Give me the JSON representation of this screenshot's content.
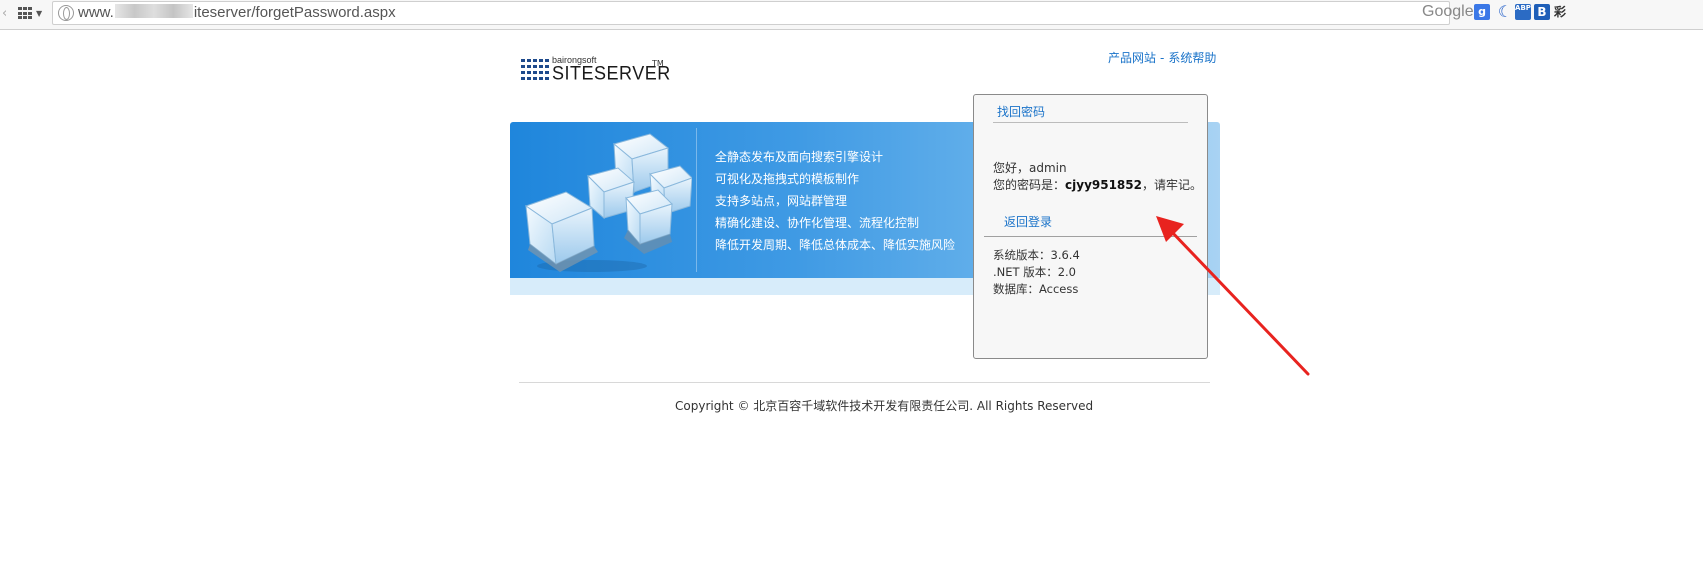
{
  "browser": {
    "url_prefix": "www.",
    "url_suffix": "iteserver/forgetPassword.aspx",
    "search_engine": "Google",
    "google_badge": "g",
    "ext_abp": "ABP",
    "ext_b": "B",
    "ext_more": "彩"
  },
  "logo": {
    "small_text": "bairongsoft",
    "main_text": "SITESERVER",
    "tm": "TM"
  },
  "top_links": {
    "product_site": "产品网站",
    "separator": "-",
    "system_help": "系统帮助"
  },
  "banner": {
    "features": [
      "全静态发布及面向搜索引擎设计",
      "可视化及拖拽式的模板制作",
      "支持多站点，网站群管理",
      "精确化建设、协作化管理、流程化控制",
      "降低开发周期、降低总体成本、降低实施风险"
    ]
  },
  "panel": {
    "title": "找回密码",
    "greeting": "您好，admin",
    "password_prefix": "您的密码是：",
    "password_value": "cjyy951852",
    "password_suffix": "，请牢记。",
    "back_link": "返回登录",
    "version_label": "系统版本：3.6.4",
    "net_label": ".NET 版本：2.0",
    "db_label": "数据库：Access"
  },
  "footer": {
    "copyright": "Copyright © 北京百容千域软件技术开发有限责任公司. All Rights Reserved"
  },
  "colors": {
    "link": "#1a73c9",
    "banner_start": "#1f86dc",
    "banner_end": "#a9d3f3",
    "annotation_arrow": "#e8231f"
  }
}
